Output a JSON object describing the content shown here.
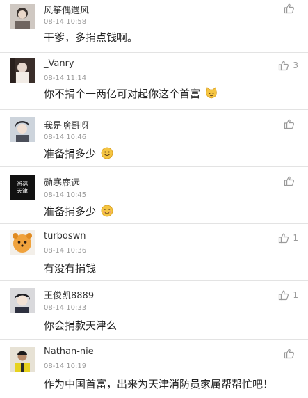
{
  "comments": [
    {
      "user": "风筝偶遇风",
      "time": "08-14 10:58",
      "text": "干爹，多捐点钱啊。",
      "likes": ""
    },
    {
      "user": "_Vanry",
      "time": "08-14 11:14",
      "text": "你不捐个一两亿可对起你这个首富",
      "likes": "3",
      "emoji": "cat-face-emoji"
    },
    {
      "user": "我是啥哥呀",
      "time": "08-14 10:46",
      "text": "准备捐多少",
      "likes": "",
      "emoji": "smile-emoji"
    },
    {
      "user": "勋寒鹿远",
      "time": "08-14 10:45",
      "text": "准备捐多少",
      "likes": "",
      "emoji": "blush-emoji",
      "avatar_text": [
        "祈福",
        "天津"
      ]
    },
    {
      "user": "turboswn",
      "time": "08-14 10:36",
      "text": "有没有捐钱",
      "likes": "1"
    },
    {
      "user": "王俊凯8889",
      "time": "08-14 10:33",
      "text": "你会捐款天津么",
      "likes": "1"
    },
    {
      "user": "Nathan-nie",
      "time": "08-14 10:19",
      "text": "作为中国首富，出来为天津消防员家属帮帮忙吧！",
      "likes": ""
    }
  ],
  "icons": {
    "like": "thumbs-up-icon"
  },
  "colors": {
    "muted": "#9a9a9a",
    "divider": "#e3e3e3",
    "emoji": "#f5c542"
  }
}
